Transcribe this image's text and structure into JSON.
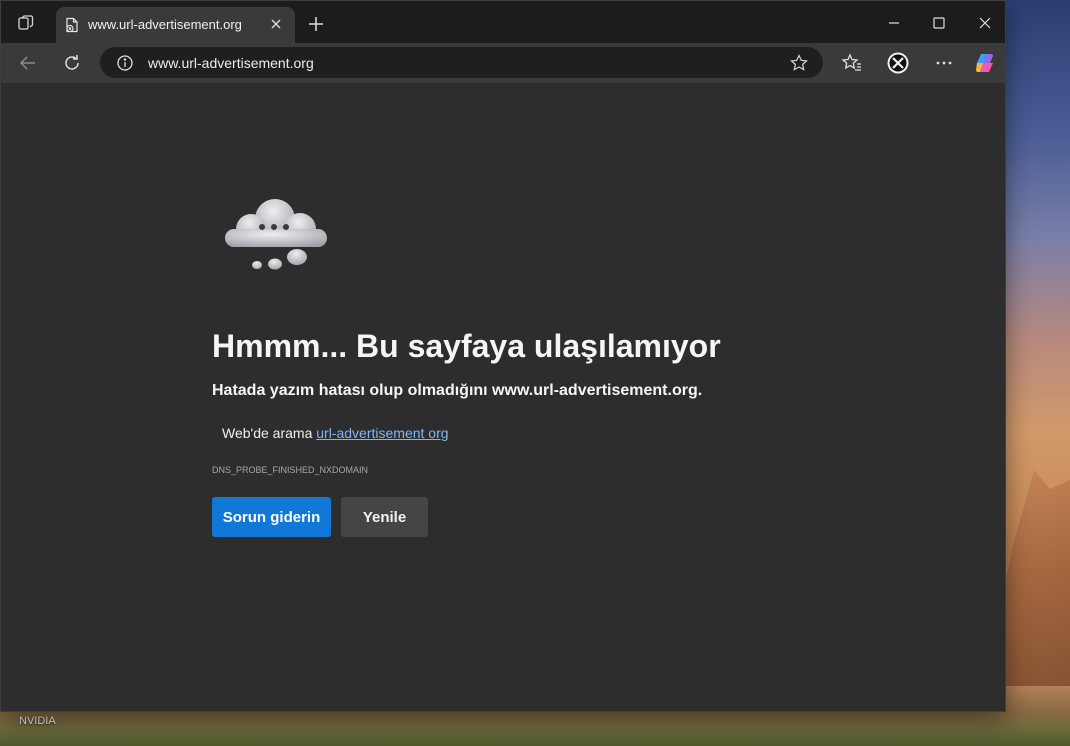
{
  "browser": {
    "tab": {
      "title": "www.url-advertisement.org"
    },
    "address_bar": {
      "url": "www.url-advertisement.org"
    }
  },
  "error_page": {
    "heading": "Hmmm... Bu sayfaya ulaşılamıyor",
    "subtext": "Hatada yazım hatası olup olmadığını www.url-advertisement.org.",
    "search_prefix": "Web'de arama",
    "search_link": "url-advertisement org",
    "error_code": "DNS_PROBE_FINISHED_NXDOMAIN",
    "buttons": {
      "primary": "Sorun giderin",
      "secondary": "Yenile"
    }
  },
  "desktop": {
    "label": "NVIDIA"
  },
  "colors": {
    "accent": "#1078d6",
    "link": "#7cb8f5",
    "page_bg": "#2d2d2d"
  },
  "icons": [
    "workspaces-icon",
    "page-error-icon",
    "close-icon",
    "plus-icon",
    "minimize-icon",
    "maximize-icon",
    "back-arrow-icon",
    "refresh-icon",
    "info-icon",
    "star-icon",
    "favorites-icon",
    "extension-icon",
    "more-icon",
    "copilot-icon",
    "cloud-icon"
  ]
}
